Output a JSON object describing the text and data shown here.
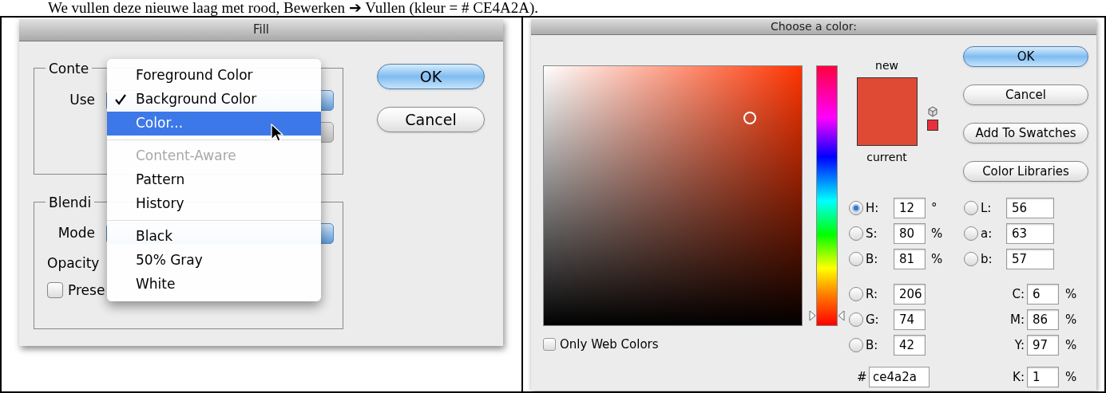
{
  "caption": "We vullen deze nieuwe laag met rood, Bewerken ➔ Vullen (kleur = # CE4A2A).",
  "fill_dialog": {
    "title": "Fill",
    "contents_legend": "Conte",
    "use_label": "Use",
    "blending_legend": "Blendi",
    "mode_label": "Mode",
    "opacity_label": "Opacity",
    "preserve": {
      "label": "Prese",
      "checked": false
    },
    "buttons": [
      {
        "label": "OK",
        "default": true
      },
      {
        "label": "Cancel",
        "default": false
      }
    ],
    "menu": {
      "groups": [
        [
          {
            "label": "Foreground Color",
            "checked": false,
            "selected": false,
            "disabled": false
          },
          {
            "label": "Background Color",
            "checked": true,
            "selected": false,
            "disabled": false
          },
          {
            "label": "Color...",
            "checked": false,
            "selected": true,
            "disabled": false
          }
        ],
        [
          {
            "label": "Content-Aware",
            "checked": false,
            "selected": false,
            "disabled": true
          },
          {
            "label": "Pattern",
            "checked": false,
            "selected": false,
            "disabled": false
          },
          {
            "label": "History",
            "checked": false,
            "selected": false,
            "disabled": false
          }
        ],
        [
          {
            "label": "Black",
            "checked": false,
            "selected": false,
            "disabled": false
          },
          {
            "label": "50% Gray",
            "checked": false,
            "selected": false,
            "disabled": false
          },
          {
            "label": "White",
            "checked": false,
            "selected": false,
            "disabled": false
          }
        ]
      ]
    }
  },
  "color_picker": {
    "title": "Choose a color:",
    "buttons": [
      {
        "label": "OK",
        "default": true
      },
      {
        "label": "Cancel",
        "default": false
      },
      {
        "label": "Add To Swatches",
        "default": false
      },
      {
        "label": "Color Libraries",
        "default": false
      }
    ],
    "new_label": "new",
    "current_label": "current",
    "hue_slider": {
      "level": 0.04
    },
    "only_web_colors": {
      "label": "Only Web Colors",
      "checked": false
    },
    "hsb": [
      {
        "label": "H:",
        "value": "12",
        "unit": "°",
        "selected": true
      },
      {
        "label": "S:",
        "value": "80",
        "unit": "%",
        "selected": false
      },
      {
        "label": "B:",
        "value": "81",
        "unit": "%",
        "selected": false
      }
    ],
    "rgb": [
      {
        "label": "R:",
        "value": "206",
        "selected": false
      },
      {
        "label": "G:",
        "value": "74",
        "selected": false
      },
      {
        "label": "B:",
        "value": "42",
        "selected": false
      }
    ],
    "lab": [
      {
        "label": "L:",
        "value": "56",
        "selected": false
      },
      {
        "label": "a:",
        "value": "63",
        "selected": false
      },
      {
        "label": "b:",
        "value": "57",
        "selected": false
      }
    ],
    "cmyk": [
      {
        "label": "C:",
        "value": "6",
        "unit": "%"
      },
      {
        "label": "M:",
        "value": "86",
        "unit": "%"
      },
      {
        "label": "Y:",
        "value": "97",
        "unit": "%"
      },
      {
        "label": "K:",
        "value": "1",
        "unit": "%"
      }
    ],
    "hex": {
      "label": "#",
      "value": "ce4a2a"
    }
  }
}
